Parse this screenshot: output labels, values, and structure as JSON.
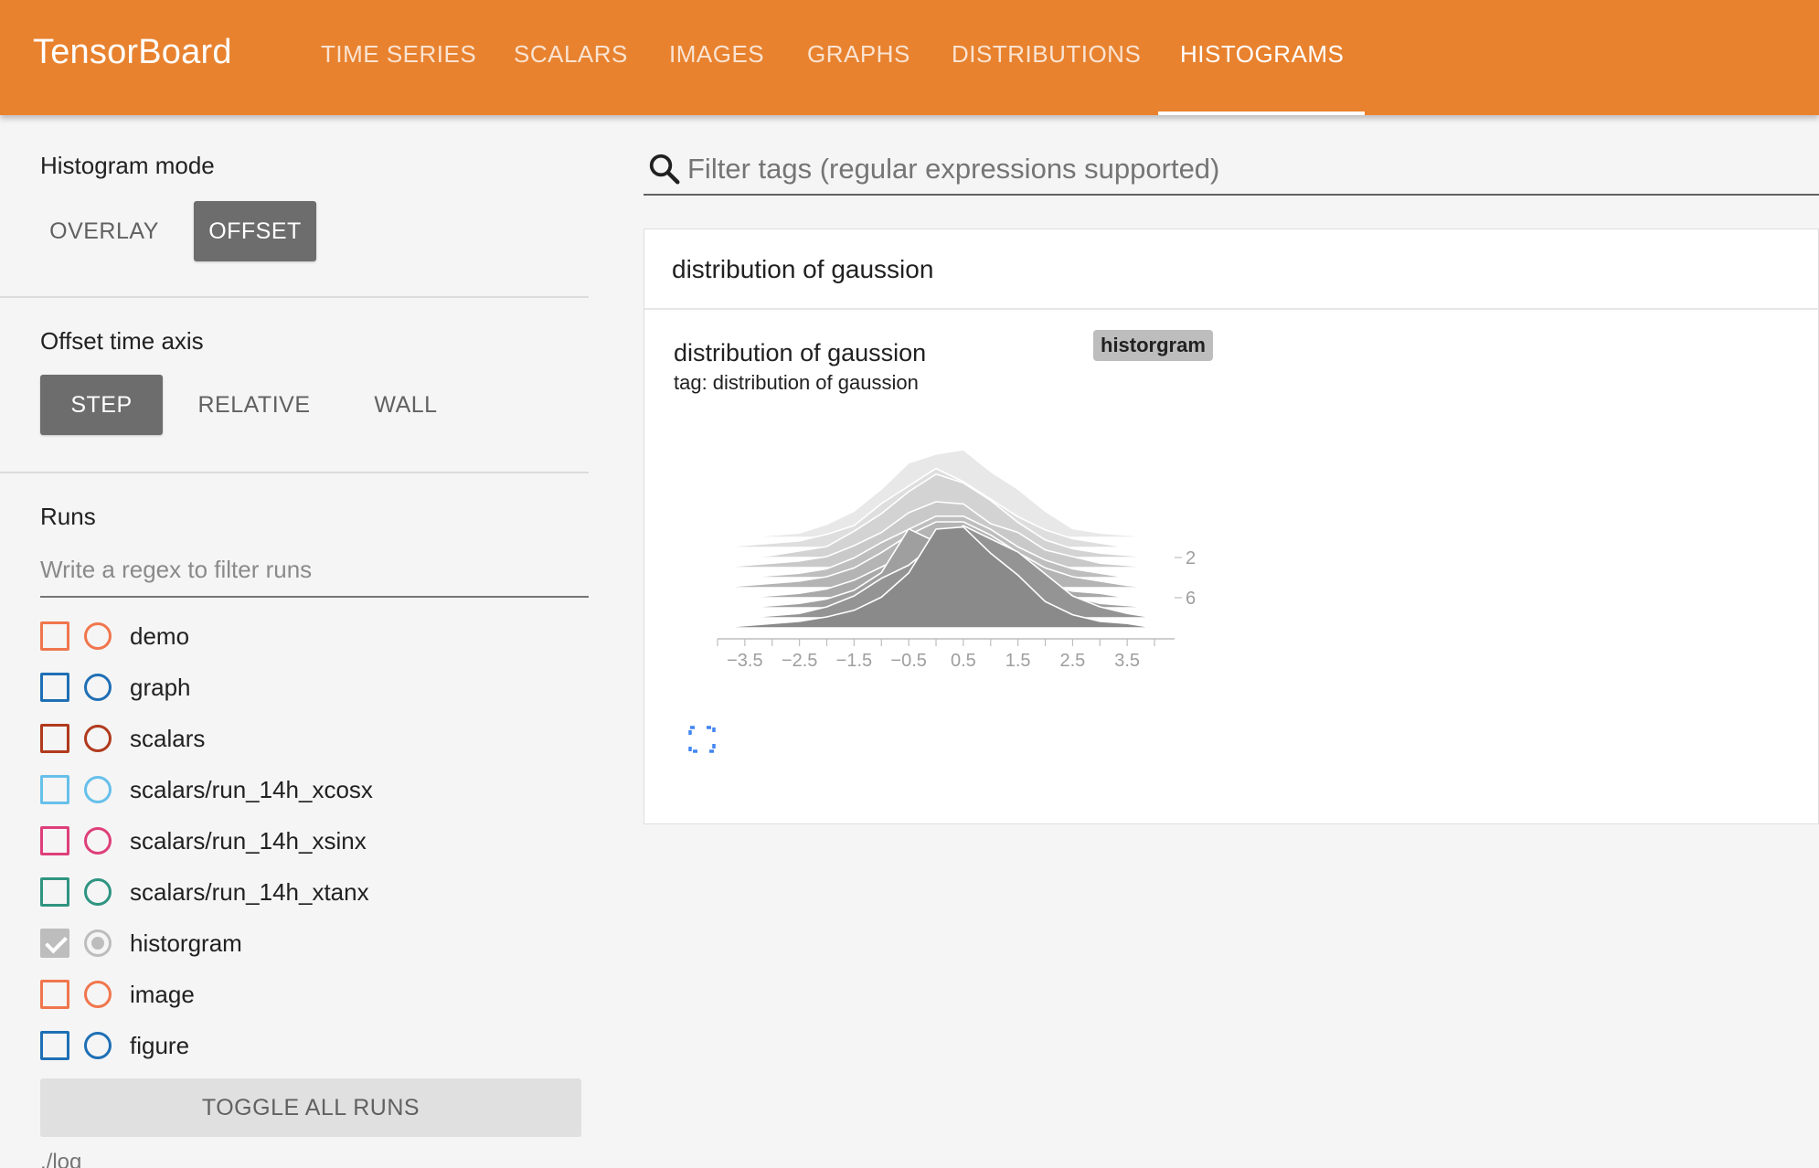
{
  "header": {
    "brand": "TensorBoard",
    "tabs": [
      {
        "label": "TIME SERIES",
        "active": false
      },
      {
        "label": "SCALARS",
        "active": false
      },
      {
        "label": "IMAGES",
        "active": false
      },
      {
        "label": "GRAPHS",
        "active": false
      },
      {
        "label": "DISTRIBUTIONS",
        "active": false
      },
      {
        "label": "HISTOGRAMS",
        "active": true
      }
    ],
    "accent_color": "#e8822f"
  },
  "sidebar": {
    "histogram_mode": {
      "title": "Histogram mode",
      "options": [
        "OVERLAY",
        "OFFSET"
      ],
      "selected": "OFFSET"
    },
    "offset_time_axis": {
      "title": "Offset time axis",
      "options": [
        "STEP",
        "RELATIVE",
        "WALL"
      ],
      "selected": "STEP"
    },
    "runs": {
      "title": "Runs",
      "filter_placeholder": "Write a regex to filter runs",
      "items": [
        {
          "name": "demo",
          "color": "#f0764d",
          "checked": false
        },
        {
          "name": "graph",
          "color": "#1f6fb5",
          "checked": false
        },
        {
          "name": "scalars",
          "color": "#b03a1c",
          "checked": false
        },
        {
          "name": "scalars/run_14h_xcosx",
          "color": "#66c0ea",
          "checked": false
        },
        {
          "name": "scalars/run_14h_xsinx",
          "color": "#de3f7a",
          "checked": false
        },
        {
          "name": "scalars/run_14h_xtanx",
          "color": "#2f9481",
          "checked": false
        },
        {
          "name": "historgram",
          "color": "#bdbdbd",
          "checked": true
        },
        {
          "name": "image",
          "color": "#f0764d",
          "checked": false
        },
        {
          "name": "figure",
          "color": "#1f6fb5",
          "checked": false
        }
      ],
      "toggle_label": "TOGGLE ALL RUNS",
      "logdir": "./log"
    }
  },
  "main": {
    "search_placeholder": "Filter tags (regular expressions supported)",
    "category_title": "distribution of gaussion",
    "card": {
      "title": "distribution of gaussion",
      "tag": "tag: distribution of gaussion",
      "run": "historgram"
    }
  },
  "chart_data": {
    "type": "area",
    "subtype": "histogram-offset (ridgeline)",
    "x_ticks": [
      "−3.5",
      "−2.5",
      "−1.5",
      "−0.5",
      "0.5",
      "1.5",
      "2.5",
      "3.5"
    ],
    "xlim": [
      -4.0,
      4.2
    ],
    "y_ticks": [
      "2",
      "6"
    ],
    "step_range": [
      0,
      9
    ],
    "bin_centers": [
      -4.0,
      -3.5,
      -3.0,
      -2.5,
      -2.0,
      -1.5,
      -1.0,
      -0.5,
      0.0,
      0.5,
      1.0,
      1.5,
      2.0,
      2.5,
      3.0,
      3.5,
      4.0
    ],
    "series": [
      {
        "step": 0,
        "values": [
          0,
          0,
          0.01,
          0.02,
          0.06,
          0.12,
          0.22,
          0.34,
          0.38,
          0.4,
          0.3,
          0.22,
          0.12,
          0.04,
          0.02,
          0.01,
          0
        ]
      },
      {
        "step": 1,
        "values": [
          0,
          0.01,
          0.02,
          0.03,
          0.06,
          0.1,
          0.2,
          0.28,
          0.36,
          0.3,
          0.22,
          0.14,
          0.08,
          0.04,
          0.02,
          0,
          0
        ]
      },
      {
        "step": 2,
        "values": [
          0,
          0,
          0.01,
          0.03,
          0.05,
          0.12,
          0.2,
          0.3,
          0.38,
          0.34,
          0.26,
          0.16,
          0.08,
          0.04,
          0.02,
          0.01,
          0
        ]
      },
      {
        "step": 3,
        "values": [
          0,
          0.01,
          0.02,
          0.03,
          0.05,
          0.1,
          0.16,
          0.25,
          0.3,
          0.29,
          0.2,
          0.16,
          0.08,
          0.05,
          0.02,
          0.01,
          0
        ]
      },
      {
        "step": 4,
        "values": [
          0,
          0,
          0.01,
          0.02,
          0.04,
          0.09,
          0.16,
          0.22,
          0.28,
          0.28,
          0.22,
          0.14,
          0.08,
          0.04,
          0.02,
          0,
          0
        ]
      },
      {
        "step": 5,
        "values": [
          0,
          0.01,
          0.02,
          0.03,
          0.05,
          0.09,
          0.16,
          0.24,
          0.3,
          0.3,
          0.24,
          0.16,
          0.09,
          0.05,
          0.03,
          0.01,
          0
        ]
      },
      {
        "step": 6,
        "values": [
          0,
          0,
          0.01,
          0.02,
          0.04,
          0.08,
          0.14,
          0.2,
          0.26,
          0.27,
          0.2,
          0.13,
          0.06,
          0.03,
          0.02,
          0,
          0
        ]
      },
      {
        "step": 7,
        "values": [
          0,
          0,
          0.01,
          0.02,
          0.04,
          0.08,
          0.16,
          0.36,
          0.3,
          0.33,
          0.28,
          0.18,
          0.1,
          0.05,
          0.02,
          0.01,
          0
        ]
      },
      {
        "step": 8,
        "values": [
          0,
          0,
          0.01,
          0.02,
          0.05,
          0.1,
          0.18,
          0.24,
          0.34,
          0.42,
          0.36,
          0.3,
          0.2,
          0.1,
          0.05,
          0.02,
          0
        ]
      },
      {
        "step": 9,
        "values": [
          0,
          0.01,
          0.02,
          0.03,
          0.05,
          0.08,
          0.14,
          0.25,
          0.45,
          0.46,
          0.34,
          0.24,
          0.12,
          0.06,
          0.03,
          0.02,
          0
        ]
      }
    ],
    "grid": false
  }
}
